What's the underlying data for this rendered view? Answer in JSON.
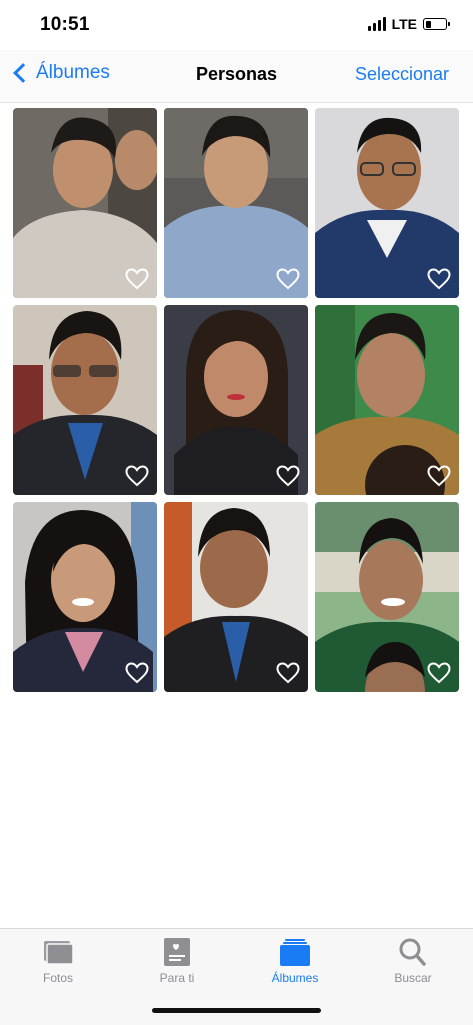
{
  "status_bar": {
    "time": "10:51",
    "network": "LTE",
    "signal_bars": 4,
    "battery_level": 0.3
  },
  "nav": {
    "back_label": "Álbumes",
    "title": "Personas",
    "select_label": "Seleccionar"
  },
  "people": [
    {
      "id": 1,
      "icon": "heart-outline-icon"
    },
    {
      "id": 2,
      "icon": "heart-outline-icon"
    },
    {
      "id": 3,
      "icon": "heart-outline-icon"
    },
    {
      "id": 4,
      "icon": "heart-outline-icon"
    },
    {
      "id": 5,
      "icon": "heart-outline-icon"
    },
    {
      "id": 6,
      "icon": "heart-outline-icon"
    },
    {
      "id": 7,
      "icon": "heart-outline-icon"
    },
    {
      "id": 8,
      "icon": "heart-outline-icon"
    },
    {
      "id": 9,
      "icon": "heart-outline-icon"
    }
  ],
  "tabs": [
    {
      "label": "Fotos",
      "icon": "photos-icon",
      "active": false
    },
    {
      "label": "Para ti",
      "icon": "for-you-icon",
      "active": false
    },
    {
      "label": "Álbumes",
      "icon": "albums-icon",
      "active": true
    },
    {
      "label": "Buscar",
      "icon": "search-icon",
      "active": false
    }
  ],
  "colors": {
    "accent": "#1a7cf5",
    "inactive_tab": "#8e8e93"
  }
}
